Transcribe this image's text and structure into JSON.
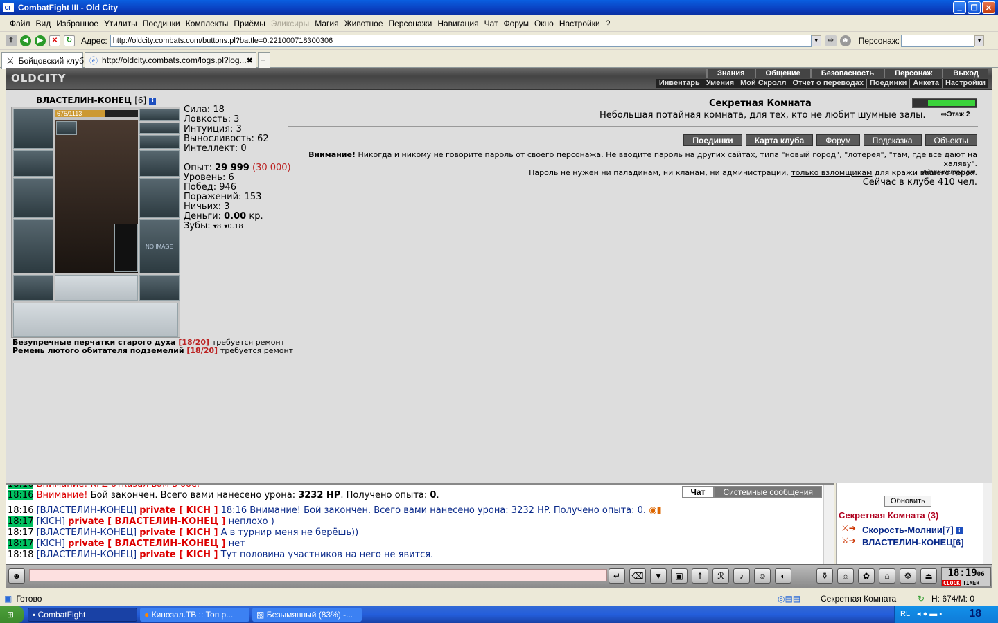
{
  "window": {
    "title": "CombatFight III - Old City",
    "app_icon": "CF"
  },
  "menu": [
    "Файл",
    "Вид",
    "Избранное",
    "Утилиты",
    "Поединки",
    "Комплекты",
    "Приёмы",
    "Эликсиры",
    "Магия",
    "Животное",
    "Персонажи",
    "Навигация",
    "Чат",
    "Форум",
    "Окно",
    "Настройки",
    "?"
  ],
  "address": {
    "label": "Адрес:",
    "url": "http://oldcity.combats.com/buttons.pl?battle=0.221000718300306",
    "persona_label": "Персонаж:"
  },
  "tabs": [
    {
      "label": "Бойцовский клуб"
    },
    {
      "label": "http://oldcity.combats.com/logs.pl?log..."
    }
  ],
  "game": {
    "logo": "OLDCITY",
    "topnav": [
      "Знания",
      "Общение",
      "Безопасность",
      "Персонаж",
      "Выход"
    ],
    "subnav": [
      "Инвентарь",
      "Умения",
      "Мой Скролл",
      "Отчет о переводах",
      "Поединки",
      "Анкета",
      "Настройки"
    ],
    "character": {
      "name": "ВЛАСТЕЛИН-КОНЕЦ",
      "level": "[6]",
      "hp": "675/1113",
      "hp_fraction": 0.606,
      "no_image": "NO IMAGE"
    },
    "stats": {
      "strength": "Сила: 18",
      "agility": "Ловкость: 3",
      "intuition": "Интуиция: 3",
      "endurance": "Выносливость: 62",
      "intellect": "Интеллект: 0",
      "exp_label": "Опыт:",
      "exp": "29 999",
      "exp_next": "(30 000)",
      "level": "Уровень: 6",
      "wins": "Побед: 946",
      "losses": "Поражений: 153",
      "draws": "Ничьих: 3",
      "money_label": "Деньги:",
      "money": "0.00",
      "money_unit": "кр.",
      "teeth_label": "Зубы:",
      "teeth": "8",
      "teeth2": "0.18"
    },
    "repairs": [
      {
        "item": "Безупречные перчатки старого духа",
        "dur": "[18/20]",
        "note": "требуется ремонт"
      },
      {
        "item": "Ремень лютого обитателя подземелий",
        "dur": "[18/20]",
        "note": "требуется ремонт"
      }
    ],
    "room": {
      "title": "Секретная Комната",
      "description": "Небольшая потайная комната, для тех, кто не любит шумные залы.",
      "floor": "Этаж 2"
    },
    "buttons": [
      "Поединки",
      "Карта клуба",
      "Форум",
      "Подсказка",
      "Объекты"
    ],
    "warning": {
      "bold": "Внимание!",
      "line1": "Никогда и никому не говорите пароль от своего персонажа. Не вводите пароль на других сайтах, типа \"новый город\", \"лотерея\", \"там, где все дают на халяву\".",
      "line2a": "Пароль не нужен ни паладинам, ни кланам, ни администрации,",
      "line2link": "только взломщикам",
      "line2b": "для кражи вашего героя.",
      "signature": "Администрация.",
      "online": "Сейчас в клубе 410 чел."
    }
  },
  "chat": {
    "tabs": [
      "Чат",
      "Системные сообщения"
    ],
    "lines": [
      {
        "time": "18:16",
        "pre": "",
        "name": "",
        "pv": "",
        "text": "",
        "warn": "Внимание!",
        "tail": "Бой закончен. Всего вами нанесено урона:",
        "dmg": "3232 HP",
        "tail2": ". Получено опыта:",
        "exp": "0",
        "end": "."
      },
      {
        "time": "18:16",
        "name": "[ВЛАСТЕЛИН-КОНЕЦ]",
        "pv": "private [ KICH ]",
        "text": "18:16 Внимание! Бой закончен. Всего вами нанесено урона: 3232 HP. Получено опыта: 0."
      },
      {
        "time": "18:17",
        "name": "[KICH]",
        "pv": "private [ ВЛАСТЕЛИН-КОНЕЦ ]",
        "text": "неплохо )"
      },
      {
        "time": "18:17",
        "name": "[ВЛАСТЕЛИН-КОНЕЦ]",
        "pv": "private [ KICH ]",
        "text": "А в турнир меня не берёшь))"
      },
      {
        "time": "18:17",
        "name": "[KICH]",
        "pv": "private [ ВЛАСТЕЛИН-КОНЕЦ ]",
        "text": "нет"
      },
      {
        "time": "18:18",
        "name": "[ВЛАСТЕЛИН-КОНЕЦ]",
        "pv": "private [ KICH ]",
        "text": "Тут половина участников на него не явится."
      }
    ],
    "cut_top": "Внимание! KPZ отказал вам в бое."
  },
  "userlist": {
    "refresh": "Обновить",
    "room": "Секретная Комната (3)",
    "users": [
      "Скорость-Молнии[7]",
      "ВЛАСТЕЛИН-КОНЕЦ[6]"
    ]
  },
  "clock": {
    "time": "18:19",
    "sec": "06",
    "clock_label": "CLOCK",
    "timer_label": "TIMER"
  },
  "status": {
    "text": "Готово",
    "room": "Секретная Комната",
    "hp": "H: 674/M: 0"
  },
  "taskbar": {
    "items": [
      "CombatFight",
      "Кинозал.ТВ :: Топ р...",
      "Безымянный (83%) -..."
    ],
    "lang": "RL",
    "time": "18"
  }
}
